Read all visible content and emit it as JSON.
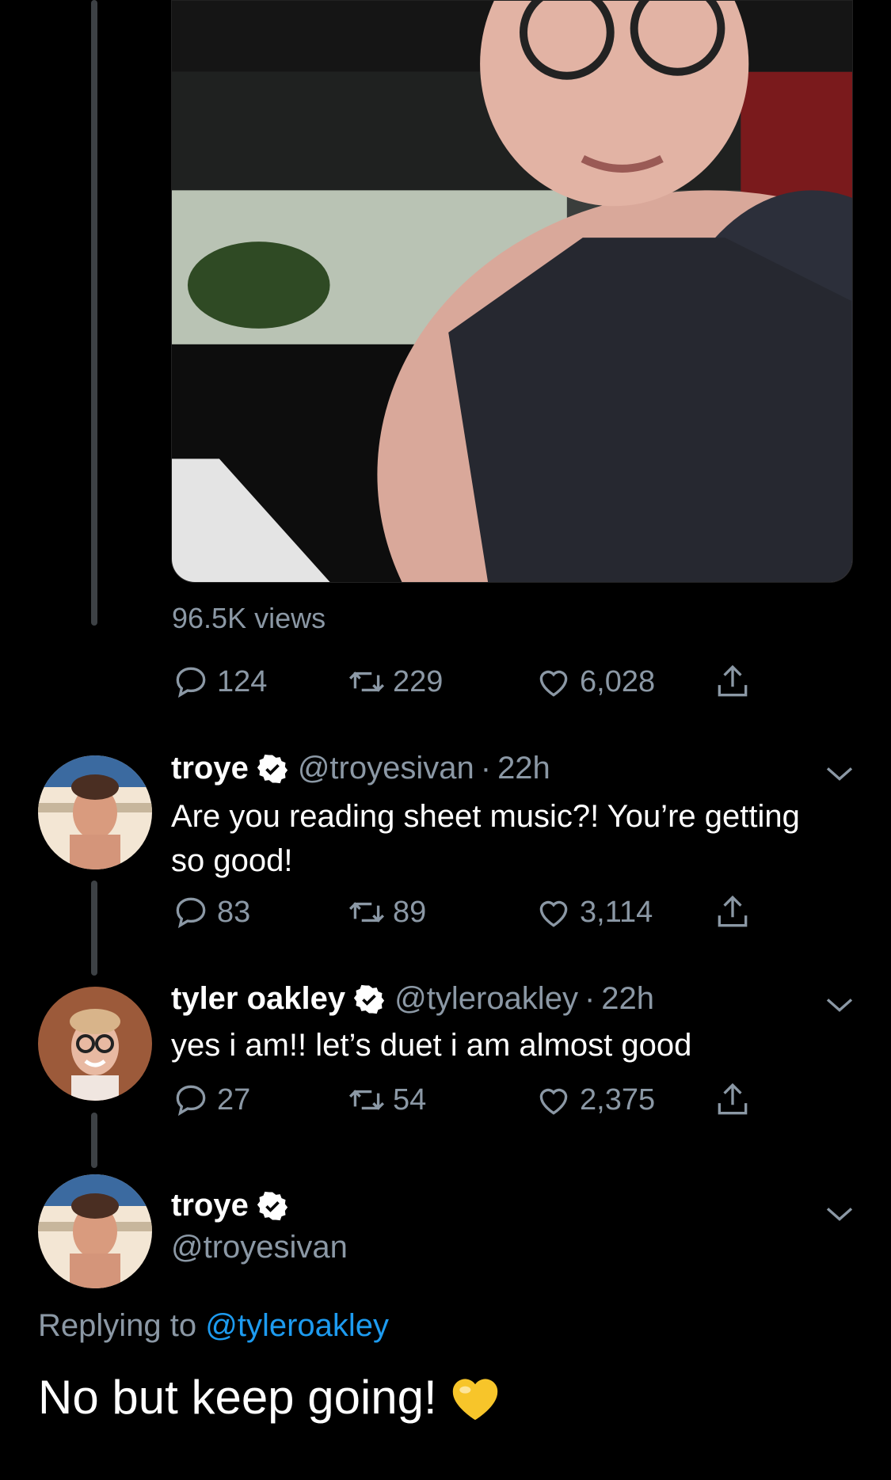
{
  "colors": {
    "background": "#000000",
    "muted": "#8b98a5",
    "link": "#1d9bf0",
    "thread_line": "#3d4145"
  },
  "first_tweet": {
    "views": "96.5K views",
    "replies": "124",
    "retweets": "229",
    "likes": "6,028"
  },
  "reply1": {
    "name": "troye",
    "handle": "@troyesivan",
    "sep": "·",
    "time": "22h",
    "text": "Are you reading sheet music?! You’re getting so good!",
    "replies": "83",
    "retweets": "89",
    "likes": "3,114"
  },
  "reply2": {
    "name": "tyler oakley",
    "handle": "@tyleroakley",
    "sep": "·",
    "time": "22h",
    "text": "yes i am!! let’s duet i am almost good",
    "replies": "27",
    "retweets": "54",
    "likes": "2,375"
  },
  "main_tweet": {
    "name": "troye",
    "handle": "@troyesivan",
    "replying_prefix": "Replying to",
    "replying_to": "@tyleroakley",
    "text": "No but keep going!",
    "emoji": "yellow-heart"
  },
  "icons": [
    "verified-badge-icon",
    "reply-icon",
    "retweet-icon",
    "like-icon",
    "share-icon",
    "chevron-down-icon",
    "yellow-heart-emoji"
  ]
}
